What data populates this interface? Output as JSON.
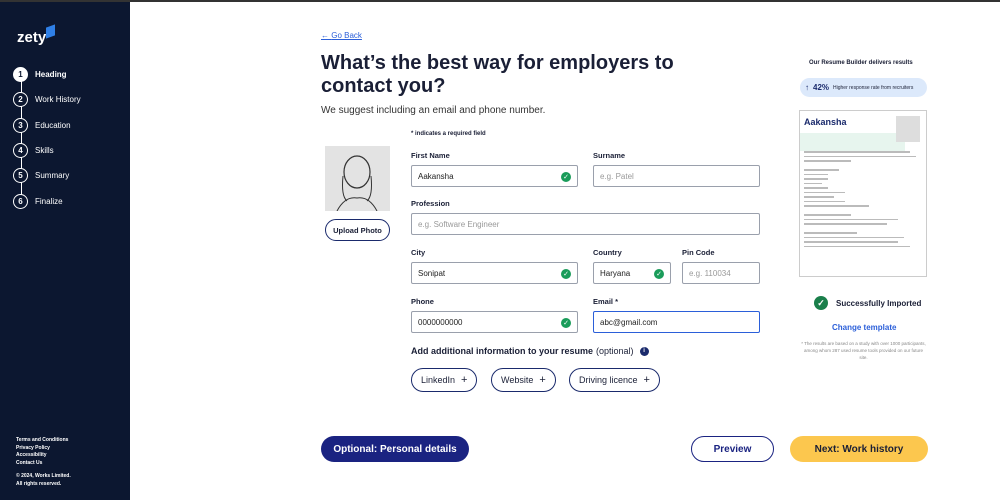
{
  "brand": {
    "name": "zety",
    "accent": "#2f7fe6"
  },
  "sidebar": {
    "steps": [
      {
        "n": "1",
        "label": "Heading"
      },
      {
        "n": "2",
        "label": "Work History"
      },
      {
        "n": "3",
        "label": "Education"
      },
      {
        "n": "4",
        "label": "Skills"
      },
      {
        "n": "5",
        "label": "Summary"
      },
      {
        "n": "6",
        "label": "Finalize"
      }
    ],
    "footer": {
      "links": [
        "Terms and Conditions",
        "Privacy Policy",
        "Accessibility",
        "Contact Us"
      ],
      "copyright": "© 2024, Works Limited.",
      "rights": "All rights reserved."
    }
  },
  "main": {
    "back": "Go Back",
    "title": "What’s the best way for employers to contact you?",
    "subtitle": "We suggest including an email and phone number.",
    "required_note": "* indicates a required field",
    "upload_photo": "Upload Photo",
    "fields": {
      "first_name": {
        "label": "First Name",
        "value": "Aakansha"
      },
      "surname": {
        "label": "Surname",
        "placeholder": "e.g. Patel"
      },
      "profession": {
        "label": "Profession",
        "placeholder": "e.g. Software Engineer"
      },
      "city": {
        "label": "City",
        "value": "Sonipat"
      },
      "country": {
        "label": "Country",
        "value": "Haryana"
      },
      "pin": {
        "label": "Pin Code",
        "placeholder": "e.g. 110034"
      },
      "phone": {
        "label": "Phone",
        "value": "0000000000"
      },
      "email": {
        "label": "Email *",
        "value": "abc@gmail.com"
      }
    },
    "additional": {
      "label": "Add additional information to your resume",
      "optional": "(optional)",
      "chips": [
        "LinkedIn",
        "Website",
        "Driving licence"
      ]
    },
    "buttons": {
      "optional": "Optional: Personal details",
      "preview": "Preview",
      "next": "Next: Work history"
    }
  },
  "right": {
    "title": "Our Resume Builder delivers results",
    "badge_value": "42%",
    "badge_text": "Higher response rate from recruiters",
    "resume_name": "Aakansha",
    "status": "Successfully Imported",
    "change_template": "Change template",
    "footnote": "* The results are based on a study with over 1000 participants, among whom 287 used resume tools provided on our future site."
  }
}
